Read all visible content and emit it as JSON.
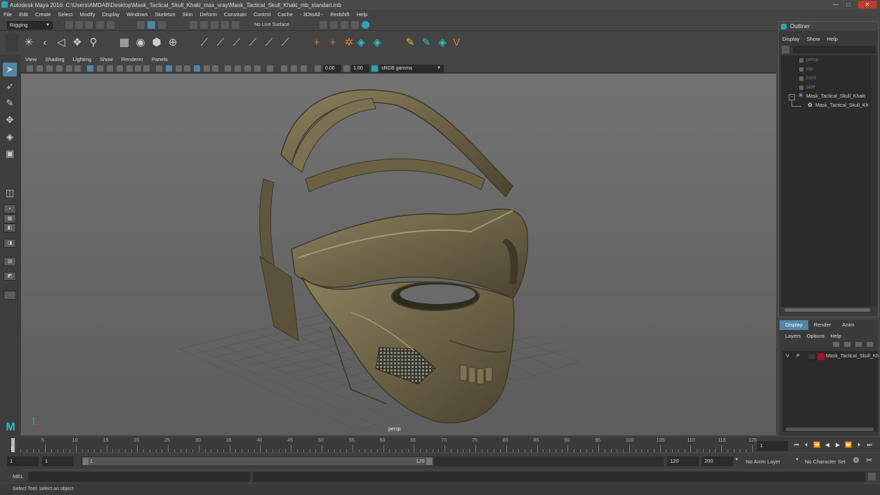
{
  "window": {
    "title": "Autodesk Maya 2016: C:\\Users\\AMDAB\\Desktop\\Mask_Tactical_Skull_Khaki_max_vray\\Mask_Tactical_Skull_Khaki_mb_standart.mb",
    "minimize": "—",
    "maximize": "□",
    "close": "✕"
  },
  "menubar": [
    "File",
    "Edit",
    "Create",
    "Select",
    "Modify",
    "Display",
    "Windows",
    "Skeleton",
    "Skin",
    "Deform",
    "Constrain",
    "Control",
    "Cache",
    "- 3DtoAll -",
    "Redshift",
    "Help"
  ],
  "statusline": {
    "mode": "Rigging",
    "live_surface": "No Live Surface"
  },
  "panel_menu": [
    "View",
    "Shading",
    "Lighting",
    "Show",
    "Renderer",
    "Panels"
  ],
  "panel_toolbar": {
    "exposure": "0.00",
    "gamma": "1.00",
    "color_space": "sRGB gamma"
  },
  "viewport": {
    "camera_label": "persp",
    "colors": {
      "background": "#6a6a6a",
      "grid": "#5a5a5a",
      "mask": "#6b6246",
      "mask_light": "#8a7f5c",
      "mask_dark": "#3f3a28"
    }
  },
  "outliner": {
    "title": "Outliner",
    "menu": [
      "Display",
      "Show",
      "Help"
    ],
    "items": [
      {
        "label": "persp",
        "dim": true
      },
      {
        "label": "top",
        "dim": true
      },
      {
        "label": "front",
        "dim": true
      },
      {
        "label": "side",
        "dim": true
      },
      {
        "label": "Mask_Tactical_Skull_Khaki",
        "dim": false
      },
      {
        "label": "Mask_Tactical_Skull_Kh",
        "dim": false
      }
    ]
  },
  "layer_editor": {
    "tabs": [
      "Display",
      "Render",
      "Anim"
    ],
    "active_tab": "Display",
    "menu": [
      "Layers",
      "Options",
      "Help"
    ],
    "layer": {
      "v": "V",
      "p": "P",
      "name": "Mask_Tactical_Skull_Kh",
      "color": "#a0142a"
    }
  },
  "timeline": {
    "ticks": [
      "5",
      "10",
      "15",
      "20",
      "25",
      "30",
      "35",
      "40",
      "45",
      "50",
      "55",
      "60",
      "65",
      "70",
      "75",
      "80",
      "85",
      "90",
      "95",
      "100",
      "105",
      "110",
      "115",
      "120"
    ],
    "start_marker": "1",
    "current_frame": "1"
  },
  "range": {
    "start": "1",
    "playback_start": "1",
    "range_start_label": "1",
    "range_end_label": "120",
    "playback_end": "120",
    "end": "200",
    "anim_layer": "No Anim Layer",
    "character_set": "No Character Set"
  },
  "command_line": {
    "label": "MEL"
  },
  "help_line": "Select Tool: select an object"
}
